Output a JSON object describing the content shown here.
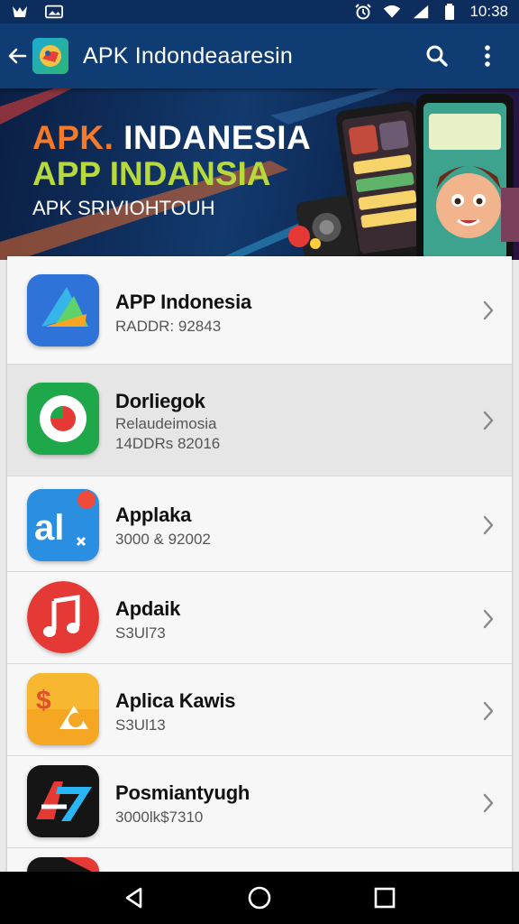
{
  "status_bar": {
    "time": "10:38",
    "left_icons": [
      "notification-icon",
      "image-icon"
    ],
    "right_icons": [
      "alarm-icon",
      "wifi-icon",
      "signal-icon",
      "battery-icon"
    ]
  },
  "app_bar": {
    "title": "APK Indondeaaresin",
    "icons": [
      "back-arrow-icon",
      "app-logo-icon",
      "search-icon",
      "more-vert-icon"
    ]
  },
  "banner": {
    "line1_accent": "APK.",
    "line1_rest": " INDANESIA",
    "line2": "APP INDANSIA",
    "line3": "APK SRIVIOHTOUH"
  },
  "apps": [
    {
      "name": "APP Indonesia",
      "sub1": "RADDR: 92843",
      "sub2": "",
      "icon": "blue-triangle-app-icon"
    },
    {
      "name": "Dorliegok",
      "sub1": "Relaudeimosia",
      "sub2": "14DDRs 82016",
      "icon": "green-circle-app-icon"
    },
    {
      "name": "Applaka",
      "sub1": "3000 & 92002",
      "sub2": "",
      "icon": "al-app-icon"
    },
    {
      "name": "Apdaik",
      "sub1": "S3Ul73",
      "sub2": "",
      "icon": "music-note-app-icon"
    },
    {
      "name": "Aplica Kawis",
      "sub1": "S3Ul13",
      "sub2": "",
      "icon": "orange-app-icon"
    },
    {
      "name": "Posmiantyugh",
      "sub1": "3000lk$7310",
      "sub2": "",
      "icon": "a7-app-icon"
    }
  ],
  "nav_bar": {
    "icons": [
      "back-nav-icon",
      "home-nav-icon",
      "recents-nav-icon"
    ]
  },
  "colors": {
    "app_bar": "#0e3c73",
    "status_bar": "#0d2d5e",
    "accent_orange": "#f47a28",
    "accent_green": "#b7d93d"
  }
}
